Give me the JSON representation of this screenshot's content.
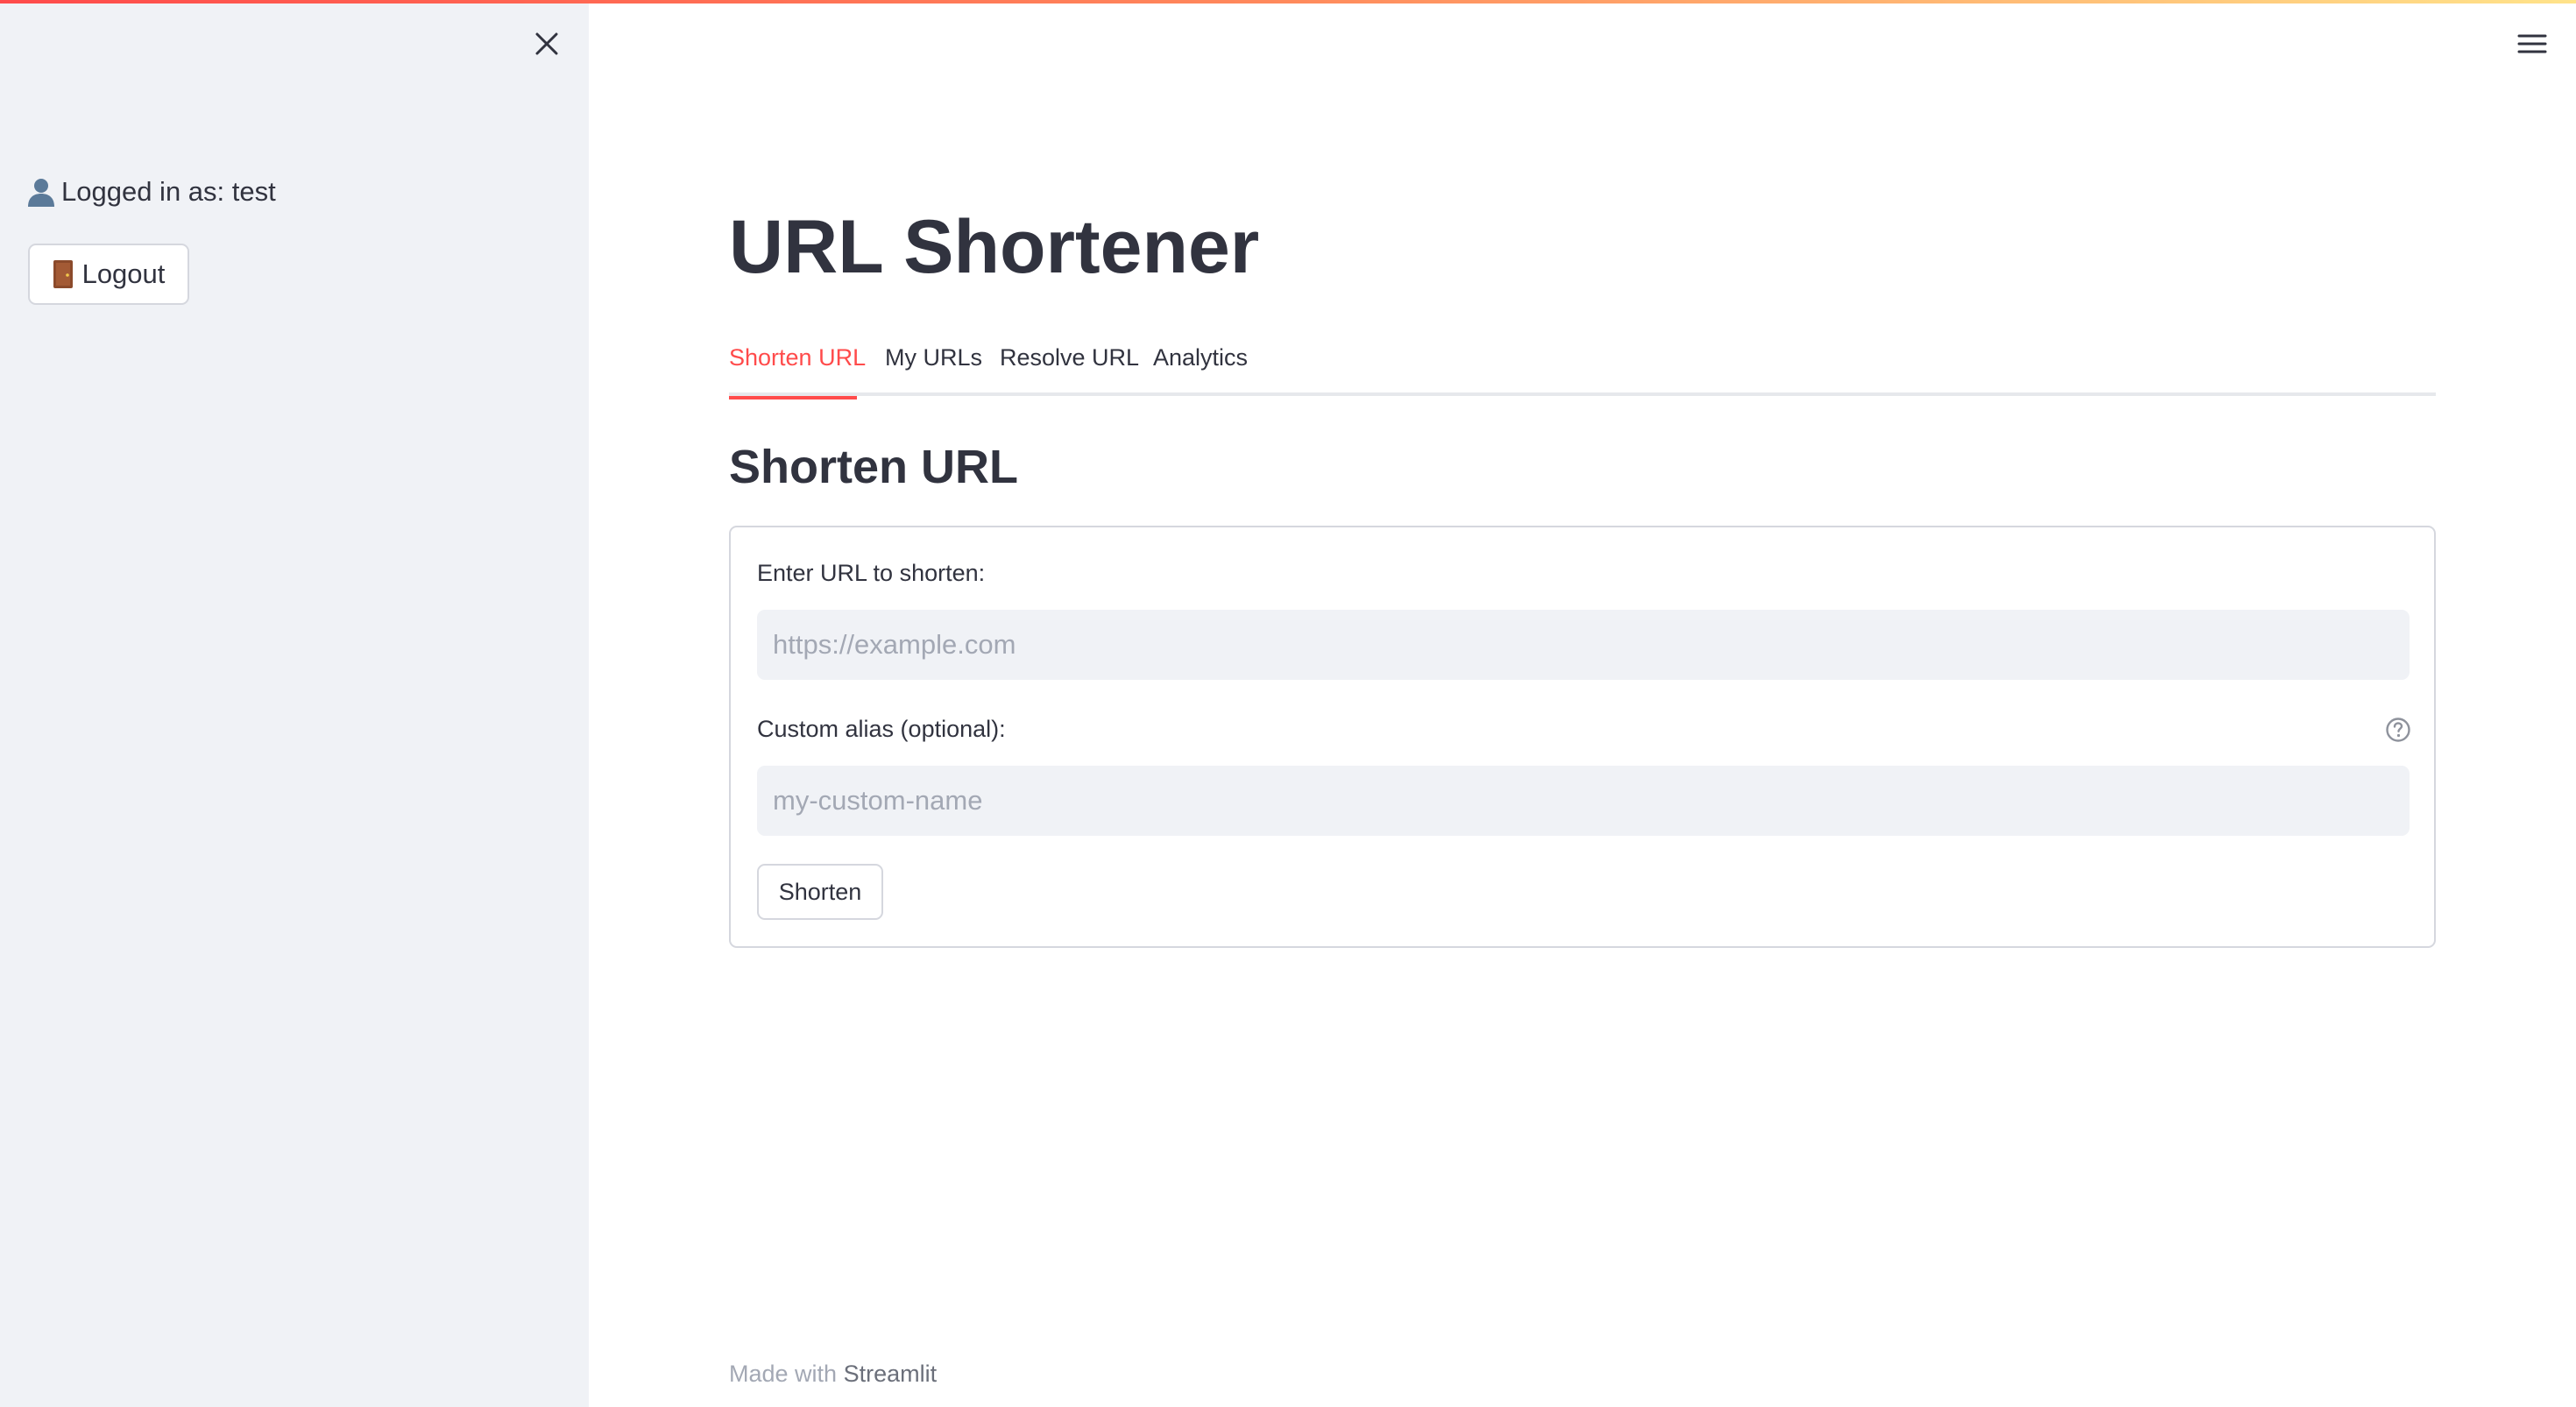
{
  "sidebar": {
    "user_text": "Logged in as: test",
    "user_icon": "bust-in-silhouette-icon",
    "logout_label": "Logout",
    "logout_icon": "door-icon",
    "close_icon": "close-icon"
  },
  "header": {
    "menu_icon": "hamburger-menu-icon"
  },
  "main": {
    "title": "URL Shortener",
    "tabs": [
      {
        "label": "Shorten URL",
        "active": true
      },
      {
        "label": "My URLs",
        "active": false
      },
      {
        "label": "Resolve URL",
        "active": false
      },
      {
        "label": "Analytics",
        "active": false
      }
    ],
    "section_heading": "Shorten URL",
    "form": {
      "url_label": "Enter URL to shorten:",
      "url_value": "",
      "url_placeholder": "https://example.com",
      "alias_label": "Custom alias (optional):",
      "alias_value": "",
      "alias_placeholder": "my-custom-name",
      "alias_help_icon": "question-circle-icon",
      "submit_label": "Shorten"
    }
  },
  "footer": {
    "prefix": "Made with",
    "brand": "Streamlit"
  },
  "colors": {
    "accent": "#ff4b4b",
    "sidebar_bg": "#f0f2f6",
    "text": "#31333f",
    "input_bg": "#f0f2f6",
    "placeholder": "#a3a8b4",
    "border": "#d5d7de"
  }
}
